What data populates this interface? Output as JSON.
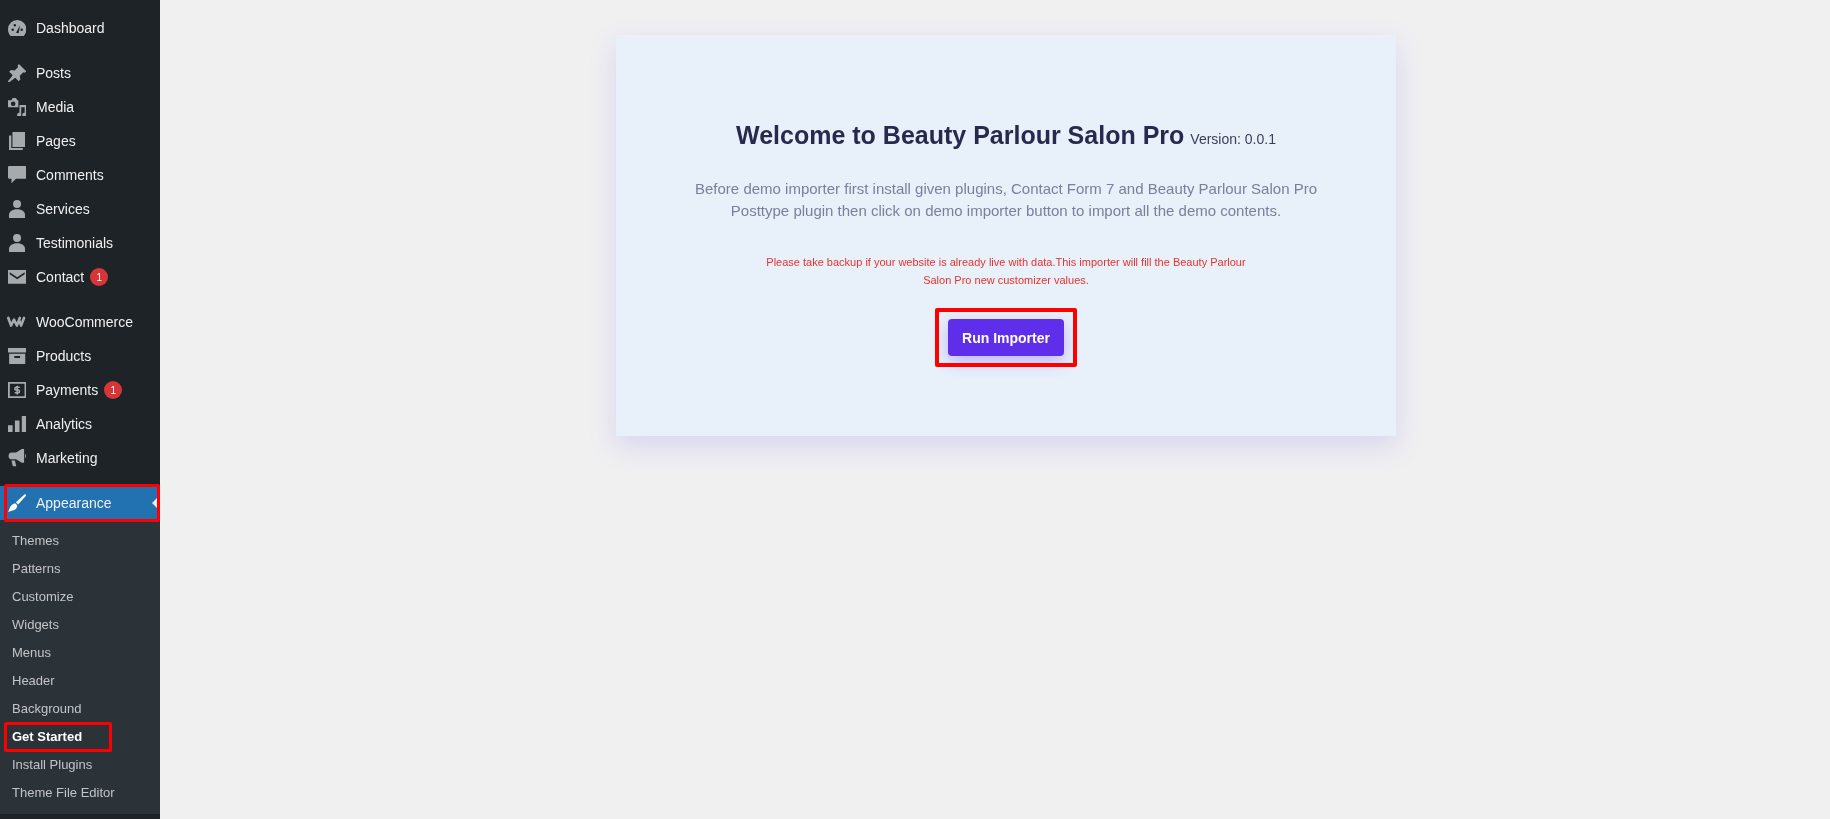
{
  "sidebar": {
    "groups": [
      {
        "items": [
          {
            "label": "Dashboard",
            "selected": false,
            "highlighted": false
          }
        ]
      },
      {
        "items": [
          {
            "label": "Posts",
            "selected": false,
            "highlighted": false
          },
          {
            "label": "Media",
            "selected": false,
            "highlighted": false
          },
          {
            "label": "Pages",
            "selected": false,
            "highlighted": false
          },
          {
            "label": "Comments",
            "selected": false,
            "highlighted": false
          },
          {
            "label": "Services",
            "selected": false,
            "highlighted": false
          },
          {
            "label": "Testimonials",
            "selected": false,
            "highlighted": false
          },
          {
            "label": "Contact",
            "badge": "1",
            "selected": false,
            "highlighted": false
          }
        ]
      },
      {
        "items": [
          {
            "label": "WooCommerce",
            "selected": false,
            "highlighted": false
          },
          {
            "label": "Products",
            "selected": false,
            "highlighted": false
          },
          {
            "label": "Payments",
            "badge": "1",
            "selected": false,
            "highlighted": false
          },
          {
            "label": "Analytics",
            "selected": false,
            "highlighted": false
          },
          {
            "label": "Marketing",
            "selected": false,
            "highlighted": false
          }
        ]
      },
      {
        "items": [
          {
            "label": "Appearance",
            "selected": true,
            "highlighted": true,
            "children": [
              {
                "label": "Themes",
                "selected": false,
                "highlighted": false
              },
              {
                "label": "Patterns",
                "selected": false,
                "highlighted": false
              },
              {
                "label": "Customize",
                "selected": false,
                "highlighted": false
              },
              {
                "label": "Widgets",
                "selected": false,
                "highlighted": false
              },
              {
                "label": "Menus",
                "selected": false,
                "highlighted": false
              },
              {
                "label": "Header",
                "selected": false,
                "highlighted": false
              },
              {
                "label": "Background",
                "selected": false,
                "highlighted": false
              },
              {
                "label": "Get Started",
                "selected": true,
                "highlighted": true
              },
              {
                "label": "Install Plugins",
                "selected": false,
                "highlighted": false
              },
              {
                "label": "Theme File Editor",
                "selected": false,
                "highlighted": false
              }
            ]
          }
        ]
      }
    ]
  },
  "welcome_card": {
    "title": "Welcome to Beauty Parlour Salon Pro",
    "version": "Version: 0.0.1",
    "description": [
      "Before demo importer first install given plugins, Contact Form 7 and Beauty Parlour Salon Pro",
      "Posttype plugin then click on demo importer button to import all the demo contents."
    ],
    "warning": [
      "Please take backup if your website is already live with data.This importer will fill the Beauty Parlour",
      "Salon Pro new customizer values."
    ],
    "button": {
      "label": "Run Importer",
      "highlighted": true
    }
  }
}
